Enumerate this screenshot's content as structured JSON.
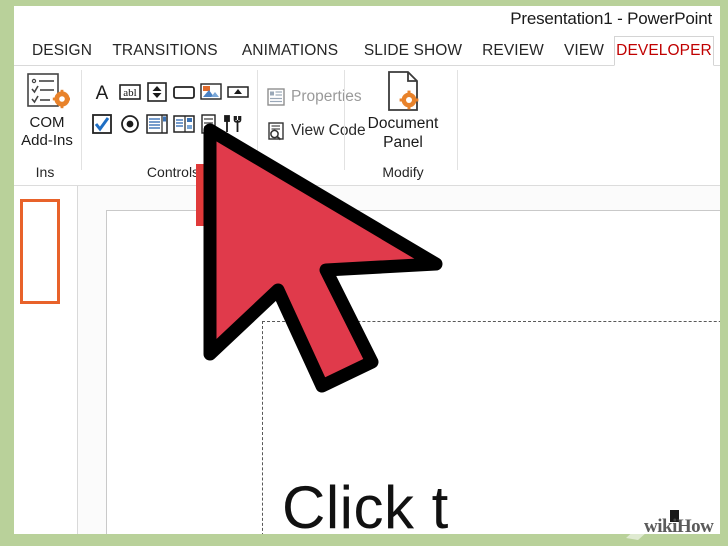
{
  "window": {
    "title": "Presentation1 - PowerPoint"
  },
  "tabs": [
    {
      "label": "DESIGN",
      "active": false
    },
    {
      "label": "TRANSITIONS",
      "active": false
    },
    {
      "label": "ANIMATIONS",
      "active": false
    },
    {
      "label": "SLIDE SHOW",
      "active": false
    },
    {
      "label": "REVIEW",
      "active": false
    },
    {
      "label": "VIEW",
      "active": false
    },
    {
      "label": "DEVELOPER",
      "active": true
    }
  ],
  "ribbon": {
    "groups": [
      {
        "label": "Ins"
      },
      {
        "label": "Controls"
      },
      {
        "label": "Modify"
      }
    ],
    "com_addins": {
      "line1": "COM",
      "line2": "Add-Ins",
      "icon": "checklist-gear-icon"
    },
    "controls": {
      "row1": [
        {
          "name": "label-control",
          "icon": "letter-a-icon"
        },
        {
          "name": "text-box-control",
          "icon": "abl-textbox-icon"
        },
        {
          "name": "spin-button-control",
          "icon": "spinner-icon"
        },
        {
          "name": "command-button-control",
          "icon": "rounded-rect-icon"
        },
        {
          "name": "image-control",
          "icon": "picture-icon"
        },
        {
          "name": "scroll-bar-control",
          "icon": "scrollbar-icon"
        }
      ],
      "row2": [
        {
          "name": "check-box-control",
          "icon": "checkbox-icon"
        },
        {
          "name": "option-button-control",
          "icon": "radio-icon"
        },
        {
          "name": "list-box-control",
          "icon": "list-box-icon"
        },
        {
          "name": "combo-box-control",
          "icon": "combo-box-icon"
        },
        {
          "name": "toggle-button-control",
          "icon": "toggle-icon"
        },
        {
          "name": "more-controls-button",
          "icon": "tools-icon"
        }
      ]
    },
    "properties_button": {
      "label": "Properties",
      "icon": "properties-icon",
      "enabled": false
    },
    "view_code_button": {
      "label": "View Code",
      "icon": "view-code-icon",
      "enabled": true
    },
    "document_panel_button": {
      "line1": "Document",
      "line2": "Panel",
      "icon": "document-gear-icon"
    }
  },
  "slide": {
    "text": "Click t",
    "placeholder": "content-placeholder"
  },
  "thumbnails": [
    {
      "index": "1",
      "selected": true
    }
  ],
  "annotations": {
    "highlight_color": "#e03a3a",
    "selection_color": "#e8622a",
    "cursor_color": "#e03a4b",
    "accent_active_tab": "#c00000",
    "frame_color": "#b9d19a"
  },
  "watermark": {
    "text": "wikiHow"
  }
}
